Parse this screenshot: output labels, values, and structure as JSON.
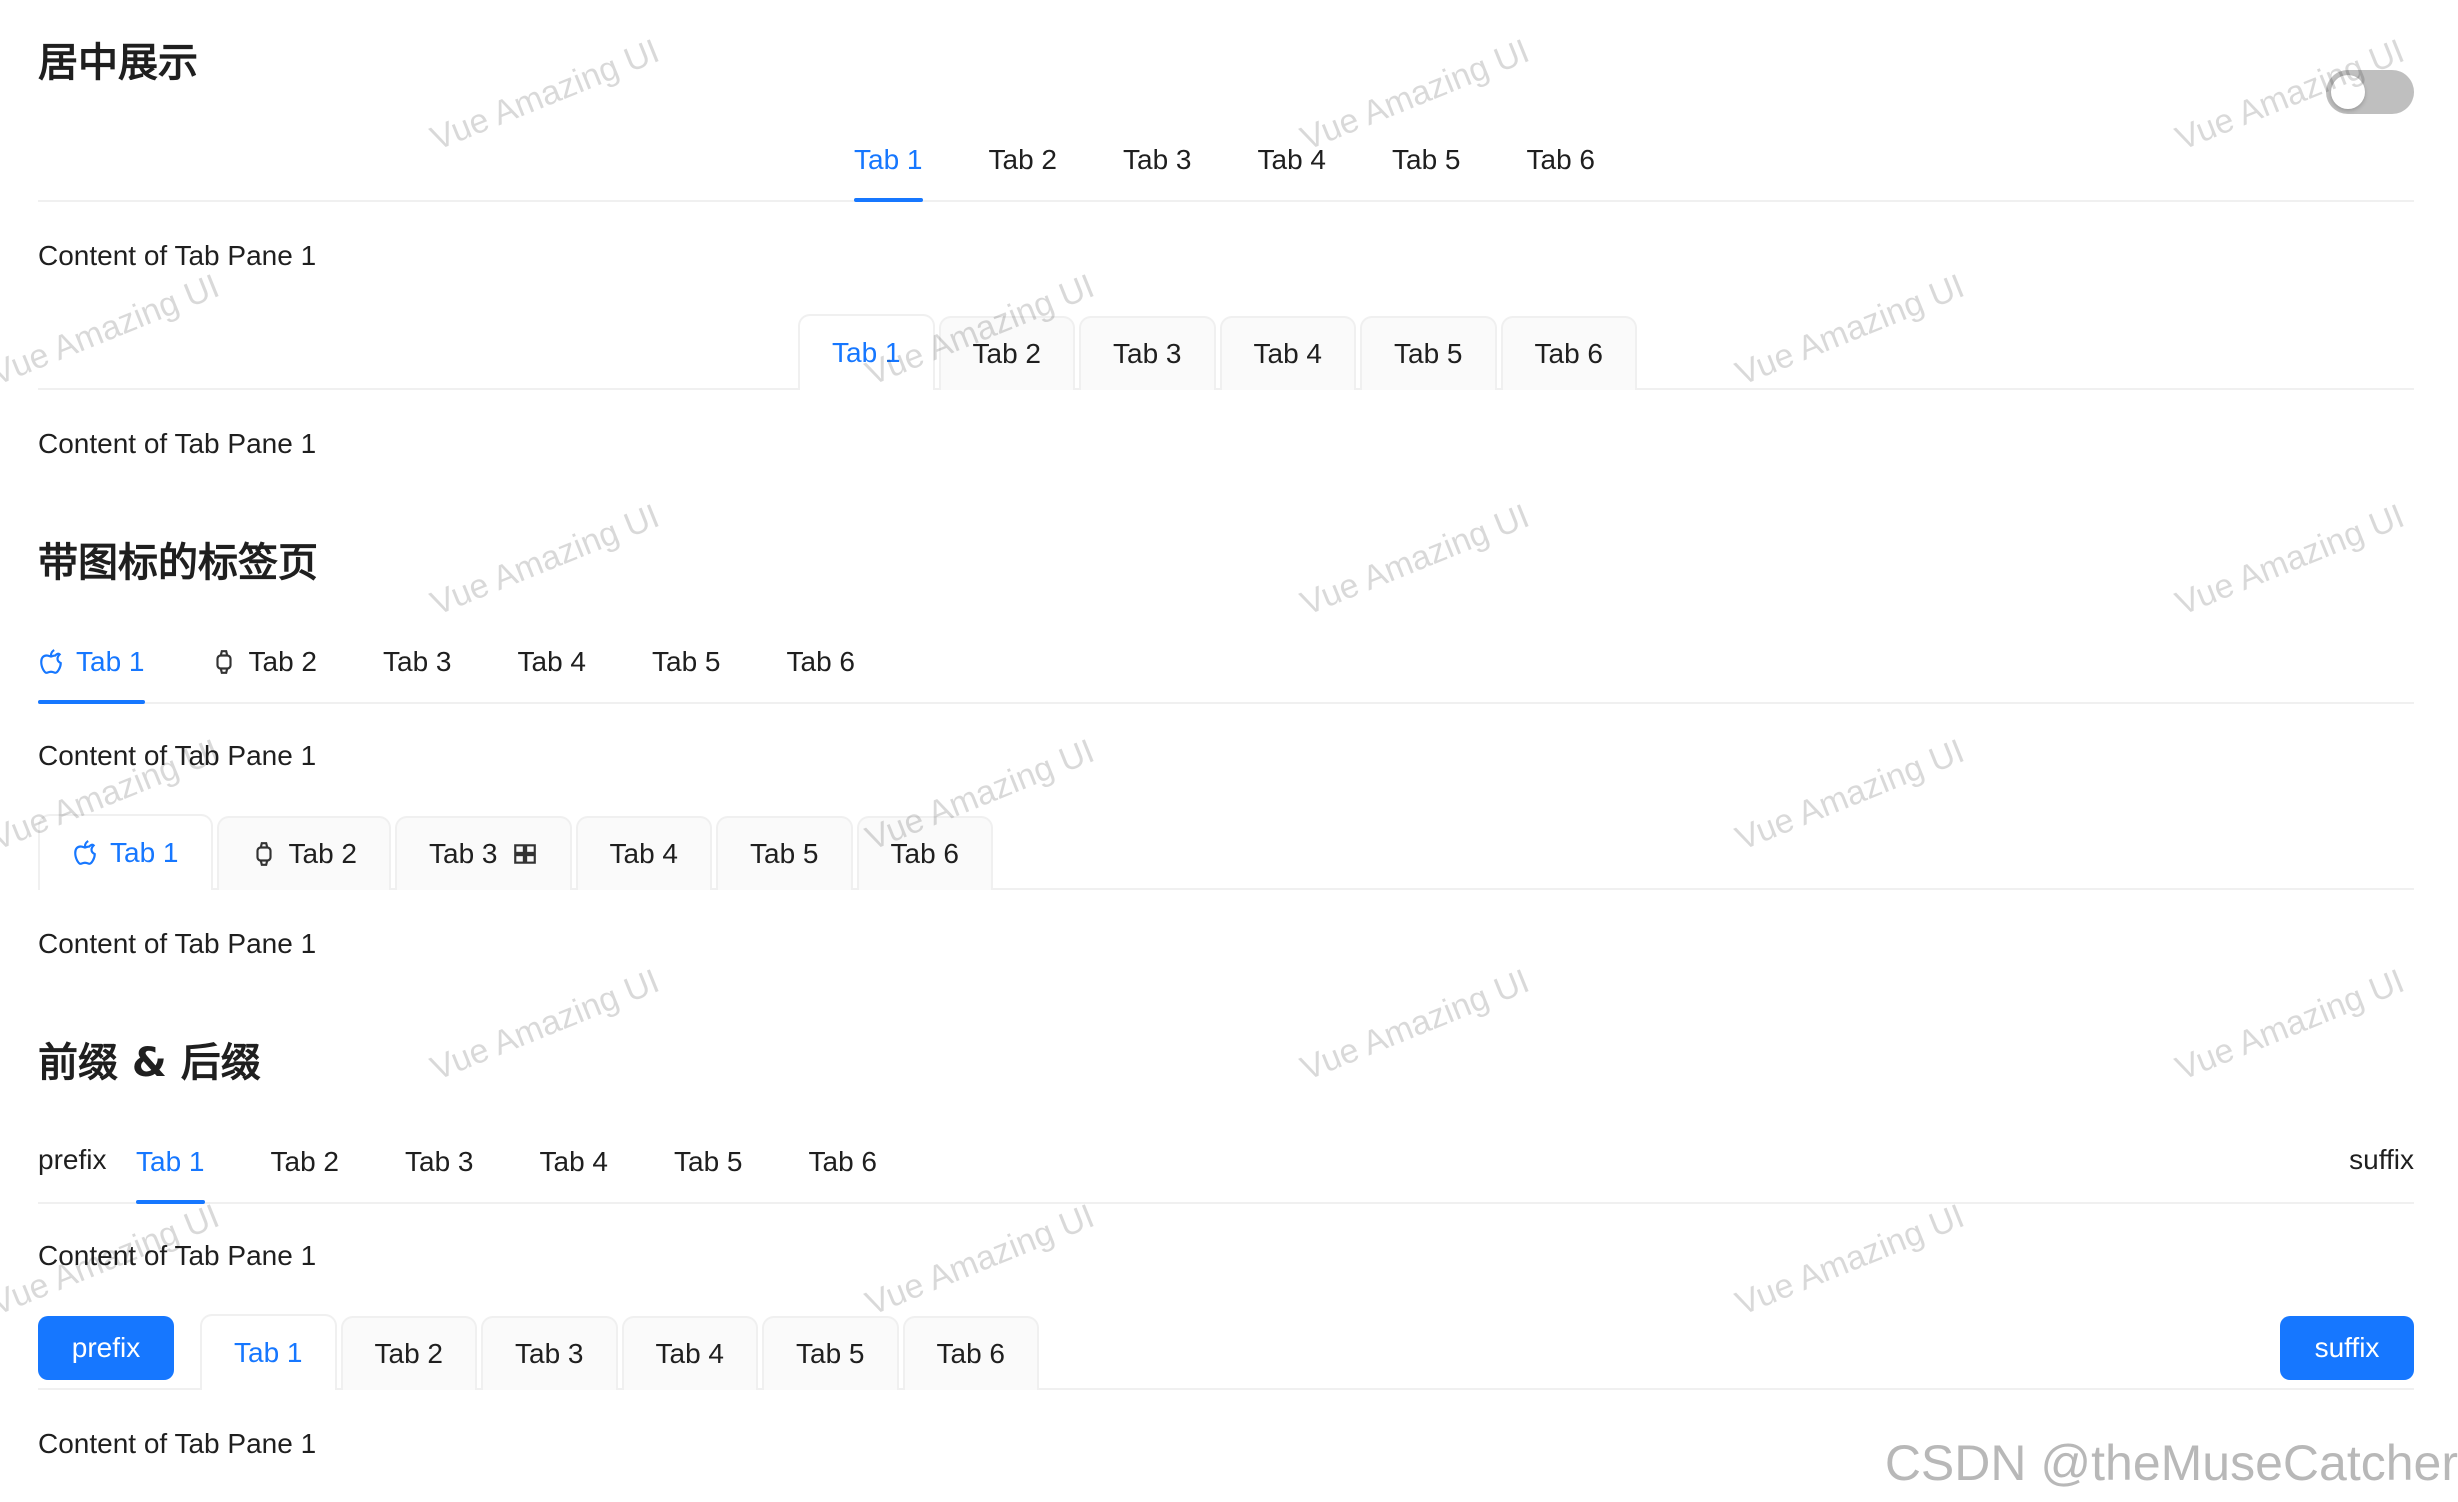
{
  "sections": {
    "centered": {
      "title": "居中展示"
    },
    "icons": {
      "title": "带图标的标签页"
    },
    "extra": {
      "title": "前缀 & 后缀"
    }
  },
  "tabs": [
    "Tab 1",
    "Tab 2",
    "Tab 3",
    "Tab 4",
    "Tab 5",
    "Tab 6"
  ],
  "content": "Content of Tab Pane 1",
  "extra": {
    "prefix": "prefix",
    "suffix": "suffix"
  },
  "watermark": "Vue Amazing UI",
  "footer_credit": "CSDN @theMuseCatcher",
  "colors": {
    "accent": "#1677ff",
    "divider": "#f0f0f0",
    "card_bg": "#fafafa",
    "toggle_off": "#bfbfbf"
  },
  "toggle": {
    "checked": false
  },
  "icons": {
    "tab1": "apple-icon",
    "tab2": "watch-icon",
    "tab3": "windows-icon"
  }
}
